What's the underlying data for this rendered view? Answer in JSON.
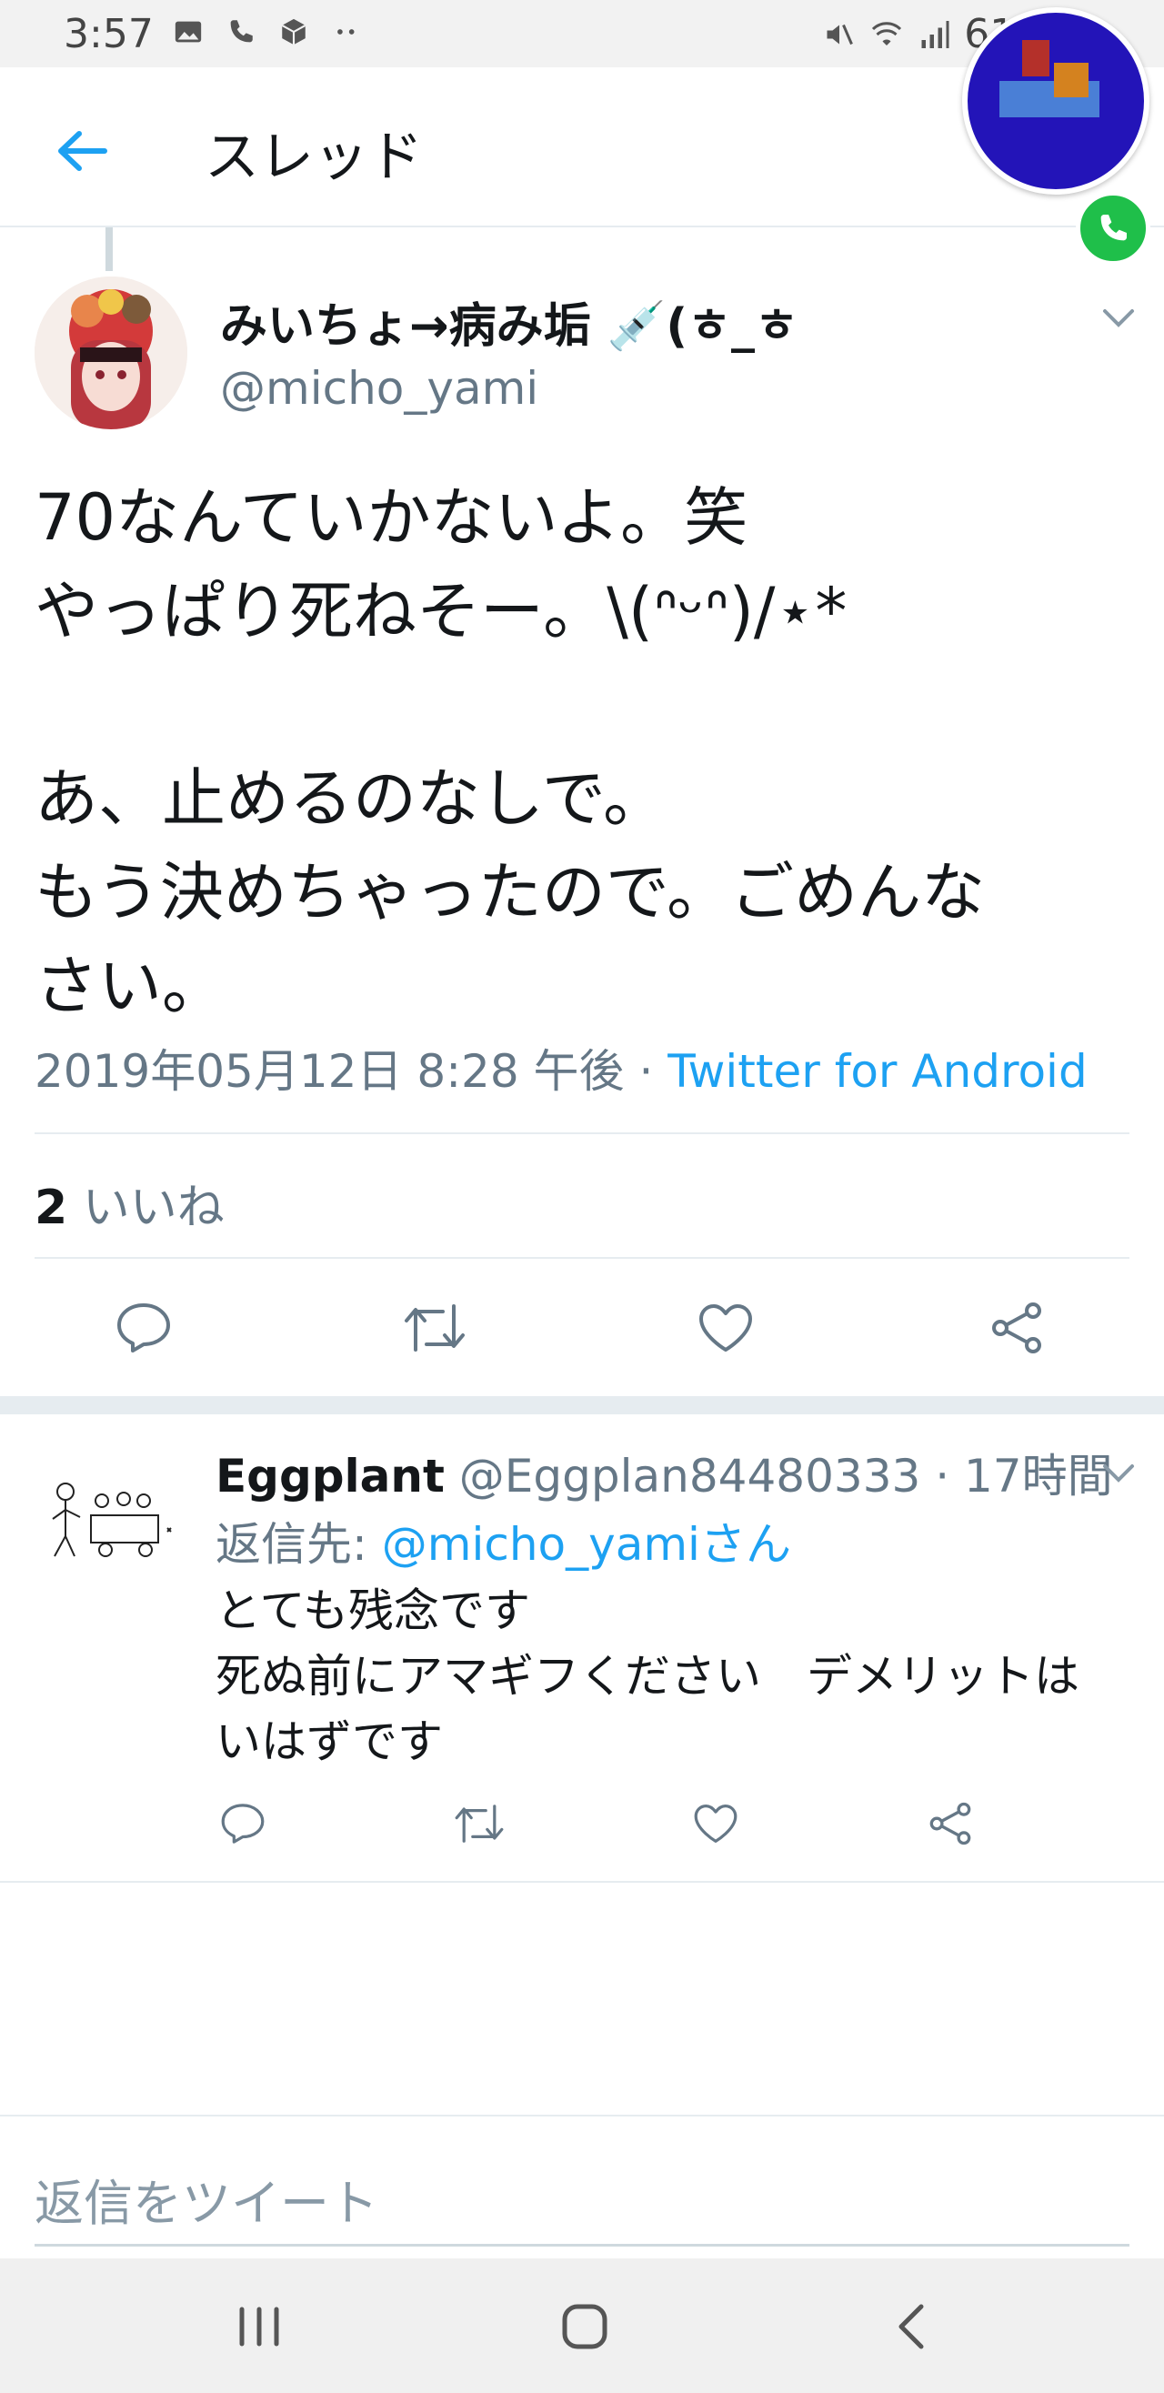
{
  "status_bar": {
    "time": "3:57",
    "battery": "61%",
    "left_icons": [
      "image-icon",
      "call-icon",
      "package-icon",
      "more-dots-icon"
    ],
    "right_icons": [
      "mute-icon",
      "wifi-icon",
      "signal-icon",
      "battery-icon"
    ]
  },
  "header": {
    "title": "スレッド"
  },
  "main_tweet": {
    "name": "みいちょ→病み垢 💉(ㅎ_ㅎ",
    "handle": "@micho_yami",
    "lines": [
      "70なんていかないよ。笑",
      "やっぱり死ねそー。\\(ᐢᵕᐢ)/⋆*",
      "",
      "あ、止めるのなしで。",
      "もう決めちゃったので。ごめんな",
      "さい。"
    ],
    "timestamp": "2019年05月12日 8:28 午後 · ",
    "source": "Twitter for Android",
    "likes_count": "2",
    "likes_label": "いいね"
  },
  "reply": {
    "name": "Eggplant",
    "handle_time": " @Eggplan84480333 · 17時間",
    "reply_to_label": "返信先: ",
    "reply_to_mention": "@micho_yamiさん",
    "lines": [
      "とても残念です",
      "死ぬ前にアマギフください　デメリットは",
      "いはずです"
    ]
  },
  "composer": {
    "placeholder": "返信をツイート"
  },
  "colors": {
    "accent": "#1da1f2",
    "secondary_text": "#657786",
    "call_bubble": "#2314b8",
    "call_green": "#1fbf4a"
  }
}
